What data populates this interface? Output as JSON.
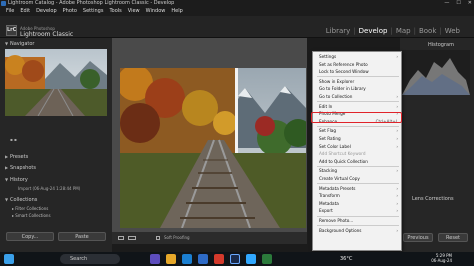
{
  "window": {
    "title": "Lightroom Catalog - Adobe Photoshop Lightroom Classic - Develop",
    "controls": [
      "—",
      "☐",
      "✕"
    ]
  },
  "menu": [
    "File",
    "Edit",
    "Develop",
    "Photo",
    "Settings",
    "Tools",
    "View",
    "Window",
    "Help"
  ],
  "brand": {
    "logo": "LrC",
    "line1": "Adobe Photoshop",
    "line2": "Lightroom Classic"
  },
  "modules": [
    "Library",
    "Develop",
    "Map",
    "Book",
    "Web"
  ],
  "left": {
    "navigator": "Navigator",
    "presets": "Presets",
    "snapshots": "Snapshots",
    "history": "History",
    "history_item": "Import (06-Aug-24 1:28:44 PM)",
    "collections": "Collections",
    "coll_items": [
      "Filter Collections",
      "Smart Collections"
    ],
    "copy": "Copy...",
    "paste": "Paste"
  },
  "toolbar": {
    "soft_proofing": "Soft Proofing"
  },
  "right": {
    "histogram": "Histogram",
    "lens": "Lens Corrections",
    "previous": "Previous",
    "reset": "Reset"
  },
  "context_menu": [
    {
      "label": "Settings",
      "arrow": true
    },
    {
      "label": "Set as Reference Photo"
    },
    {
      "label": "Lock to Second Window"
    },
    {
      "sep": true
    },
    {
      "label": "Show in Explorer"
    },
    {
      "label": "Go to Folder in Library"
    },
    {
      "label": "Go to Collection",
      "arrow": true
    },
    {
      "sep": true
    },
    {
      "label": "Edit In",
      "arrow": true
    },
    {
      "label": "Photo Merge",
      "arrow": true
    },
    {
      "label": "Enhance...",
      "shortcut": "Ctrl+Alt+I"
    },
    {
      "sep": true
    },
    {
      "label": "Set Flag",
      "arrow": true
    },
    {
      "label": "Set Rating",
      "arrow": true
    },
    {
      "label": "Set Color Label",
      "arrow": true
    },
    {
      "label": "Add Shortcut Keyword",
      "disabled": true
    },
    {
      "label": "Add to Quick Collection"
    },
    {
      "sep": true
    },
    {
      "label": "Stacking",
      "arrow": true
    },
    {
      "label": "Create Virtual Copy"
    },
    {
      "sep": true
    },
    {
      "label": "Metadata Presets",
      "arrow": true
    },
    {
      "label": "Transform",
      "arrow": true
    },
    {
      "label": "Metadata",
      "arrow": true
    },
    {
      "label": "Export",
      "arrow": true
    },
    {
      "sep": true
    },
    {
      "label": "Remove Photo..."
    },
    {
      "sep": true
    },
    {
      "label": "Background Options",
      "arrow": true
    }
  ],
  "taskbar": {
    "search": "Search",
    "temperature": "36°C",
    "time": "5:29 PM",
    "date": "06-Aug-24"
  },
  "colors": {
    "highlight": "#e0232a",
    "panel": "#262626",
    "menu_bg": "#f2f2f2"
  }
}
